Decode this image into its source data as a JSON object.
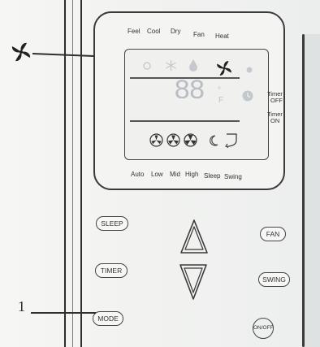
{
  "lcd_top_modes": [
    "Feel",
    "Cool",
    "Dry",
    "Fan",
    "Heat"
  ],
  "lcd_digits": "88",
  "timer_labels": [
    "Timer",
    "OFF",
    "Timer",
    "ON"
  ],
  "fan_modes": [
    "Auto",
    "Low",
    "Mid",
    "High",
    "Sleep",
    "Swing"
  ],
  "buttons": {
    "sleep": "SLEEP",
    "timer": "TIMER",
    "mode": "MODE",
    "fan": "FAN",
    "swing": "SWING",
    "onoff": "ON/OFF"
  },
  "annotation_number": "1",
  "icons": {
    "pointer_icon": "fan-icon",
    "up": "up-arrow-icon",
    "down": "down-arrow-icon"
  }
}
